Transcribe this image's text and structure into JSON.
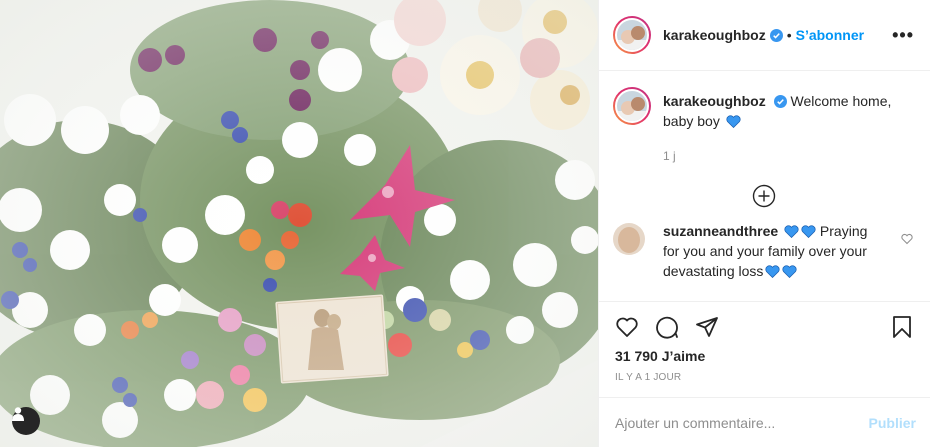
{
  "post": {
    "author": "karakeoughboz",
    "follow_label": "S’abonner",
    "separator": "•",
    "more_label": "•••",
    "caption_text": "Welcome home, baby boy",
    "caption_time": "1 j",
    "comment": {
      "username": "suzanneandthree",
      "text": "Praying for you and your family over your devastating loss"
    },
    "likes": "31 790 J’aime",
    "date": "IL Y A 1 JOUR",
    "comment_placeholder": "Ajouter un commentaire...",
    "publish_label": "Publier"
  },
  "colors": {
    "accent": "#0095f6",
    "heart_blue": "#3897f0",
    "muted": "#8e8e8e"
  },
  "icons": [
    "verified-badge-icon",
    "more-options-icon",
    "load-more-comments-icon",
    "like-icon",
    "comment-icon",
    "share-icon",
    "save-icon",
    "user-tag-icon"
  ]
}
